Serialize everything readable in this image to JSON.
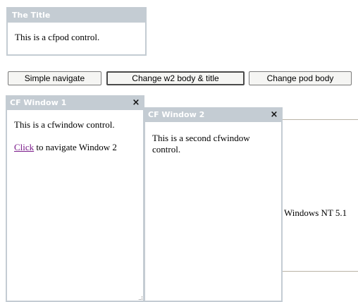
{
  "pod": {
    "title": "The Title",
    "body": "This is a cfpod control."
  },
  "buttons": {
    "simple_navigate": "Simple navigate",
    "change_w2": "Change w2 body & title",
    "change_pod": "Change pod body"
  },
  "background": {
    "text": "Windows NT 5.1"
  },
  "window1": {
    "title": "CF Window 1",
    "close_glyph": "×",
    "body": "This is a cfwindow control.",
    "link_text": "Click",
    "link_rest": " to navigate Window 2"
  },
  "window2": {
    "title": "CF Window 2",
    "close_glyph": "×",
    "body": "This is a second cfwindow control."
  },
  "colors": {
    "header": "#c4ccd3",
    "link": "#7a1a8a"
  }
}
